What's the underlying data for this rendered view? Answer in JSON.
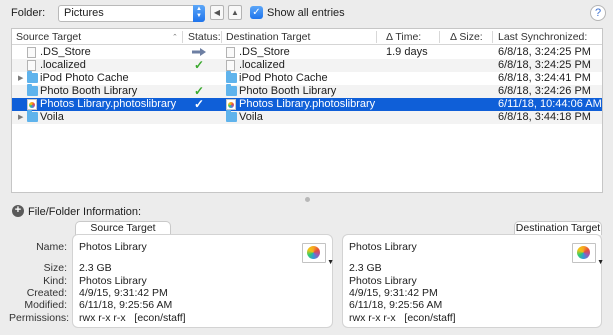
{
  "toolbar": {
    "folder_label": "Folder:",
    "folder_value": "Pictures",
    "back_icon": "triangle-left-icon",
    "up_icon": "triangle-up-icon",
    "show_all_checked": true,
    "show_all_label": "Show all entries",
    "help_label": "?"
  },
  "table": {
    "columns": {
      "source": "Source Target",
      "status": "Status:",
      "destination": "Destination Target",
      "time": "Δ Time:",
      "size": "Δ Size:",
      "last_sync": "Last Synchronized:"
    },
    "rows": [
      {
        "src": ".DS_Store",
        "icon": "document-icon",
        "expandable": false,
        "status": "arrow",
        "dst": ".DS_Store",
        "time": "1.9 days",
        "size": "",
        "sync": "6/8/18, 3:24:25 PM",
        "selected": false
      },
      {
        "src": ".localized",
        "icon": "document-icon",
        "expandable": false,
        "status": "check",
        "dst": ".localized",
        "time": "",
        "size": "",
        "sync": "6/8/18, 3:24:25 PM",
        "selected": false
      },
      {
        "src": "iPod Photo Cache",
        "icon": "folder-icon",
        "expandable": true,
        "status": "",
        "dst": "iPod Photo Cache",
        "time": "",
        "size": "",
        "sync": "6/8/18, 3:24:41 PM",
        "selected": false
      },
      {
        "src": "Photo Booth Library",
        "icon": "folder-icon",
        "expandable": false,
        "status": "check",
        "dst": "Photo Booth Library",
        "time": "",
        "size": "",
        "sync": "6/8/18, 3:24:26 PM",
        "selected": false
      },
      {
        "src": "Photos Library.photoslibrary",
        "icon": "photos-library-icon",
        "expandable": false,
        "status": "check",
        "dst": "Photos Library.photoslibrary",
        "time": "",
        "size": "",
        "sync": "6/11/18, 10:44:06 AM",
        "selected": true
      },
      {
        "src": "Voila",
        "icon": "folder-icon",
        "expandable": true,
        "status": "",
        "dst": "Voila",
        "time": "",
        "size": "",
        "sync": "6/8/18, 3:44:18 PM",
        "selected": false
      }
    ]
  },
  "info": {
    "header": "File/Folder Information:",
    "source_tab": "Source Target",
    "destination_tab": "Destination Target",
    "labels": {
      "name": "Name:",
      "size": "Size:",
      "kind": "Kind:",
      "created": "Created:",
      "modified": "Modified:",
      "permissions": "Permissions:"
    },
    "source": {
      "name": "Photos Library",
      "size": "2.3 GB",
      "kind": "Photos Library",
      "created": "4/9/15, 9:31:42 PM",
      "modified": "6/11/18, 9:25:56 AM",
      "permissions": "rwx r-x r-x   [econ/staff]"
    },
    "destination": {
      "name": "Photos Library",
      "size": "2.3 GB",
      "kind": "Photos Library",
      "created": "4/9/15, 9:31:42 PM",
      "modified": "6/11/18, 9:25:56 AM",
      "permissions": "rwx r-x r-x   [econ/staff]"
    }
  },
  "colors": {
    "selection": "#0f5fd8",
    "check": "#3aa92d",
    "folder": "#5fb3ec"
  }
}
